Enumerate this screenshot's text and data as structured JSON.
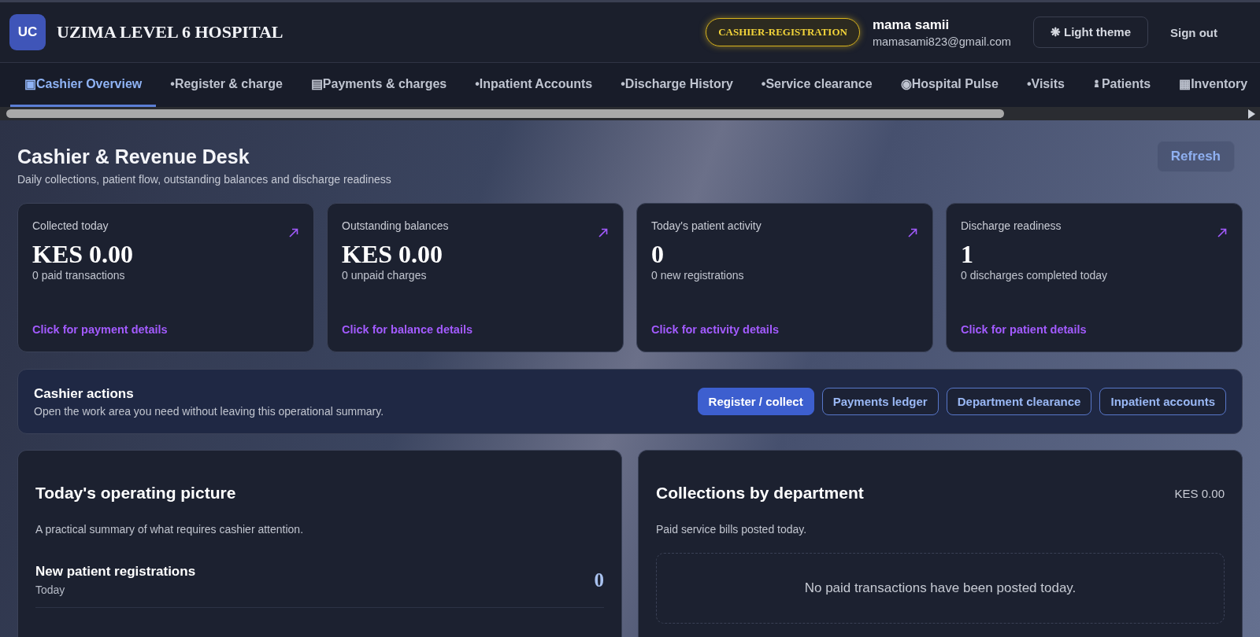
{
  "brand": {
    "logo": "UC",
    "name": "UZIMA LEVEL 6 HOSPITAL"
  },
  "role_badge": "CASHIER-REGISTRATION",
  "user": {
    "name": "mama samii",
    "email": "mamasami823@gmail.com"
  },
  "theme_button": {
    "icon": "❋",
    "label": "Light theme"
  },
  "sign_out": "Sign out",
  "tabs": [
    {
      "label": "▣Cashier Overview",
      "selected": true,
      "kind": "text"
    },
    {
      "label": "•Register & charge",
      "selected": false,
      "kind": "text"
    },
    {
      "label": "▤Payments & charges",
      "selected": false,
      "kind": "text"
    },
    {
      "label": "•Inpatient Accounts",
      "selected": false,
      "kind": "text"
    },
    {
      "label": "•Discharge History",
      "selected": false,
      "kind": "text"
    },
    {
      "label": "•Service clearance",
      "selected": false,
      "kind": "text"
    },
    {
      "label": "◉Hospital Pulse",
      "selected": false,
      "kind": "text"
    },
    {
      "label": "•Visits",
      "selected": false,
      "kind": "text"
    },
    {
      "label": "Patients",
      "selected": false,
      "kind": "person"
    },
    {
      "label": "▦Inventory",
      "selected": false,
      "kind": "text"
    }
  ],
  "page": {
    "title": "Cashier & Revenue Desk",
    "subtitle": "Daily collections, patient flow, outstanding balances and discharge readiness",
    "refresh": "Refresh"
  },
  "stats": [
    {
      "label": "Collected today",
      "value": "KES 0.00",
      "note": "0 paid transactions",
      "link": "Click for payment details"
    },
    {
      "label": "Outstanding balances",
      "value": "KES 0.00",
      "note": "0 unpaid charges",
      "link": "Click for balance details"
    },
    {
      "label": "Today's patient activity",
      "value": "0",
      "note": "0 new registrations",
      "link": "Click for activity details"
    },
    {
      "label": "Discharge readiness",
      "value": "1",
      "note": "0 discharges completed today",
      "link": "Click for patient details"
    }
  ],
  "actions": {
    "title": "Cashier actions",
    "subtitle": "Open the work area you need without leaving this operational summary.",
    "buttons": [
      {
        "label": "Register / collect",
        "selected": true
      },
      {
        "label": "Payments ledger",
        "selected": false
      },
      {
        "label": "Department clearance",
        "selected": false
      },
      {
        "label": "Inpatient accounts",
        "selected": false
      }
    ]
  },
  "operating": {
    "title": "Today's operating picture",
    "subtitle": "A practical summary of what requires cashier attention.",
    "rows": [
      {
        "title": "New patient registrations",
        "period": "Today",
        "value": "0"
      }
    ]
  },
  "collections": {
    "title": "Collections by department",
    "total": "KES 0.00",
    "subtitle": "Paid service bills posted today.",
    "empty": "No paid transactions have been posted today."
  }
}
